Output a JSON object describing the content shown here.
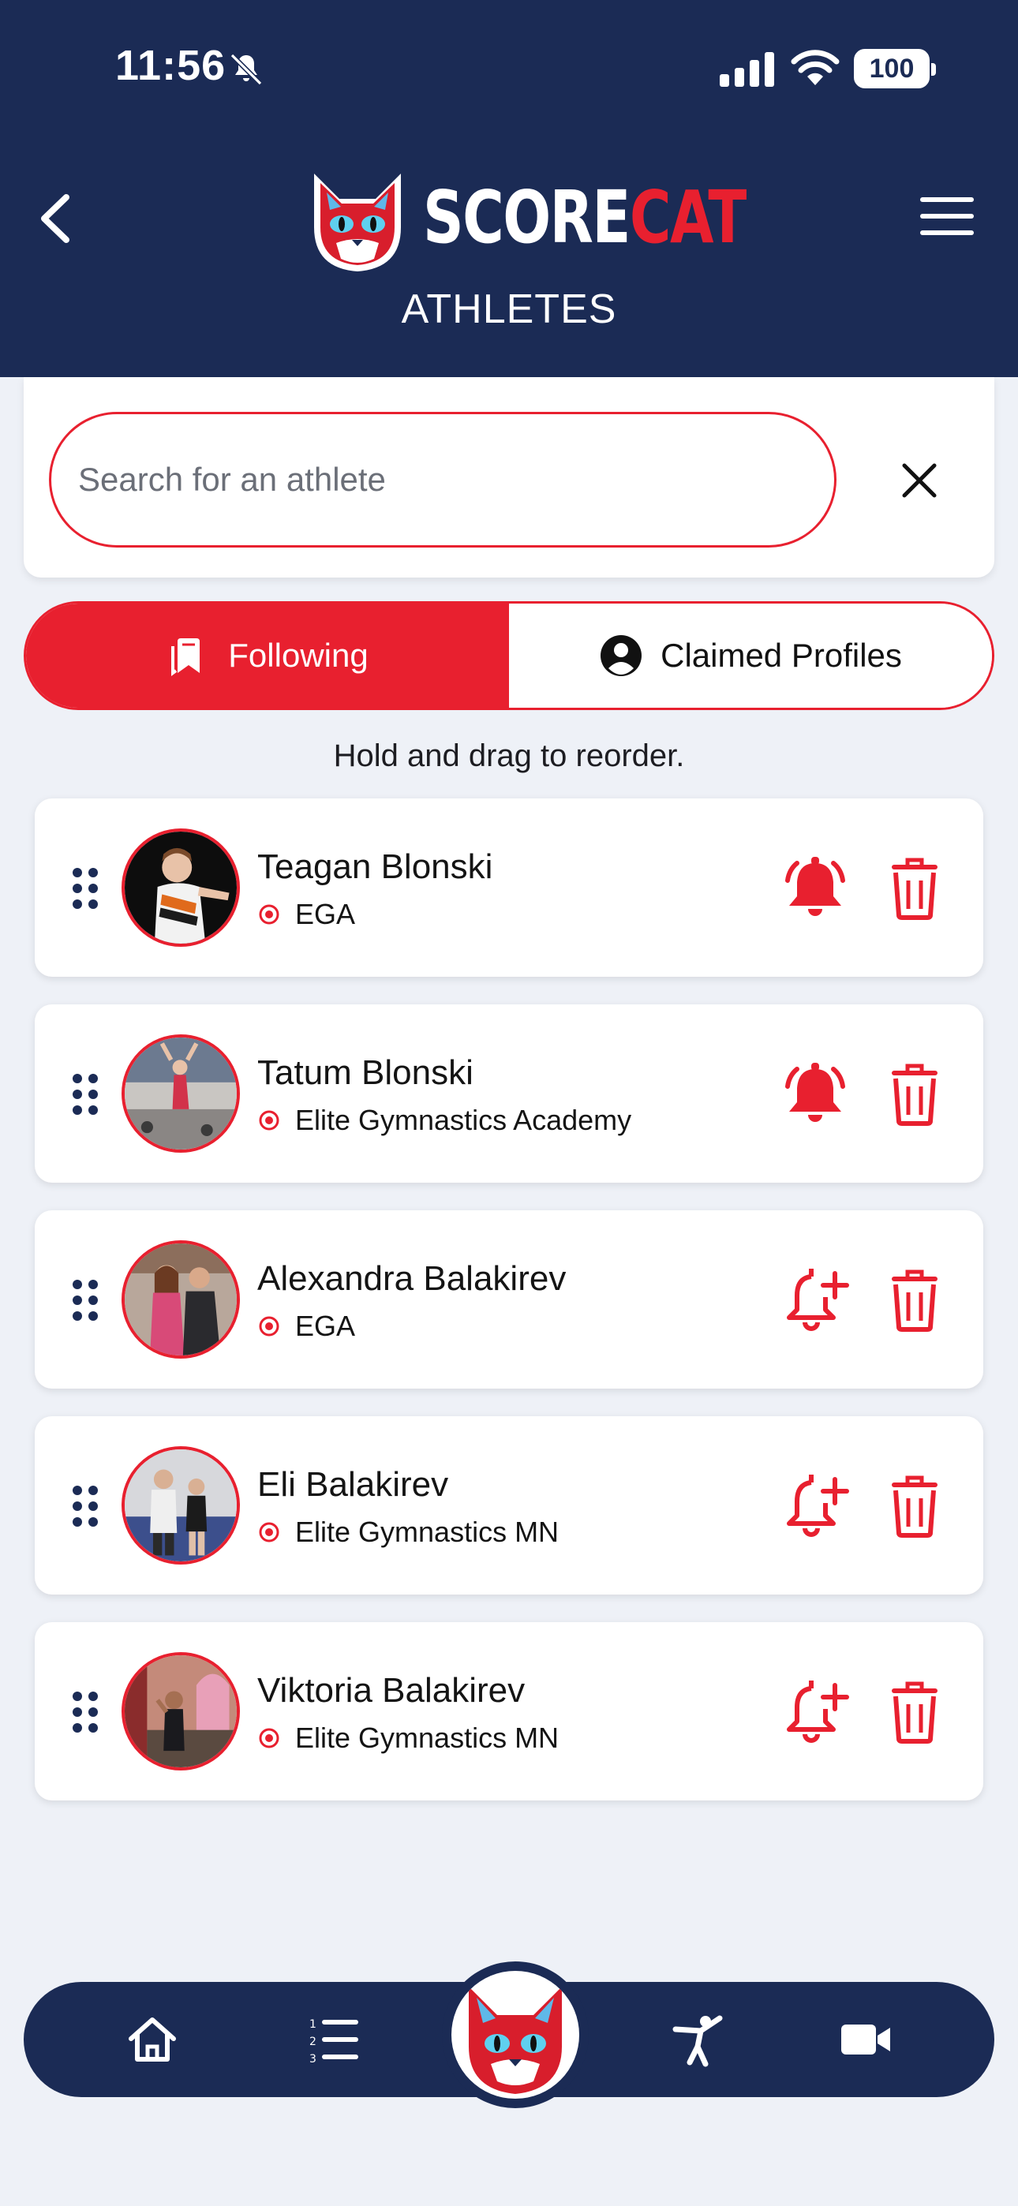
{
  "status_bar": {
    "time": "11:56",
    "battery": "100"
  },
  "header": {
    "logo_word_1": "SCORE",
    "logo_word_2": "CAT",
    "title": "ATHLETES"
  },
  "search": {
    "placeholder": "Search for an athlete",
    "value": ""
  },
  "tabs": [
    {
      "label": "Following",
      "active": true,
      "icon": "bookmark-icon"
    },
    {
      "label": "Claimed Profiles",
      "active": false,
      "icon": "user-circle-icon"
    }
  ],
  "hint": "Hold and drag to reorder.",
  "athletes": [
    {
      "name": "Teagan Blonski",
      "gym": "EGA",
      "notifications": "on"
    },
    {
      "name": "Tatum Blonski",
      "gym": "Elite Gymnastics Academy",
      "notifications": "on"
    },
    {
      "name": "Alexandra Balakirev",
      "gym": "EGA",
      "notifications": "off"
    },
    {
      "name": "Eli Balakirev",
      "gym": "Elite Gymnastics MN",
      "notifications": "off"
    },
    {
      "name": "Viktoria Balakirev",
      "gym": "Elite Gymnastics MN",
      "notifications": "off"
    }
  ],
  "bottom_nav": [
    "home-icon",
    "ranked-list-icon",
    "scorecat-logo",
    "gymnast-icon",
    "video-icon"
  ],
  "colors": {
    "navy": "#1b2b55",
    "accent_red": "#e8202f",
    "background": "#eef1f7"
  }
}
